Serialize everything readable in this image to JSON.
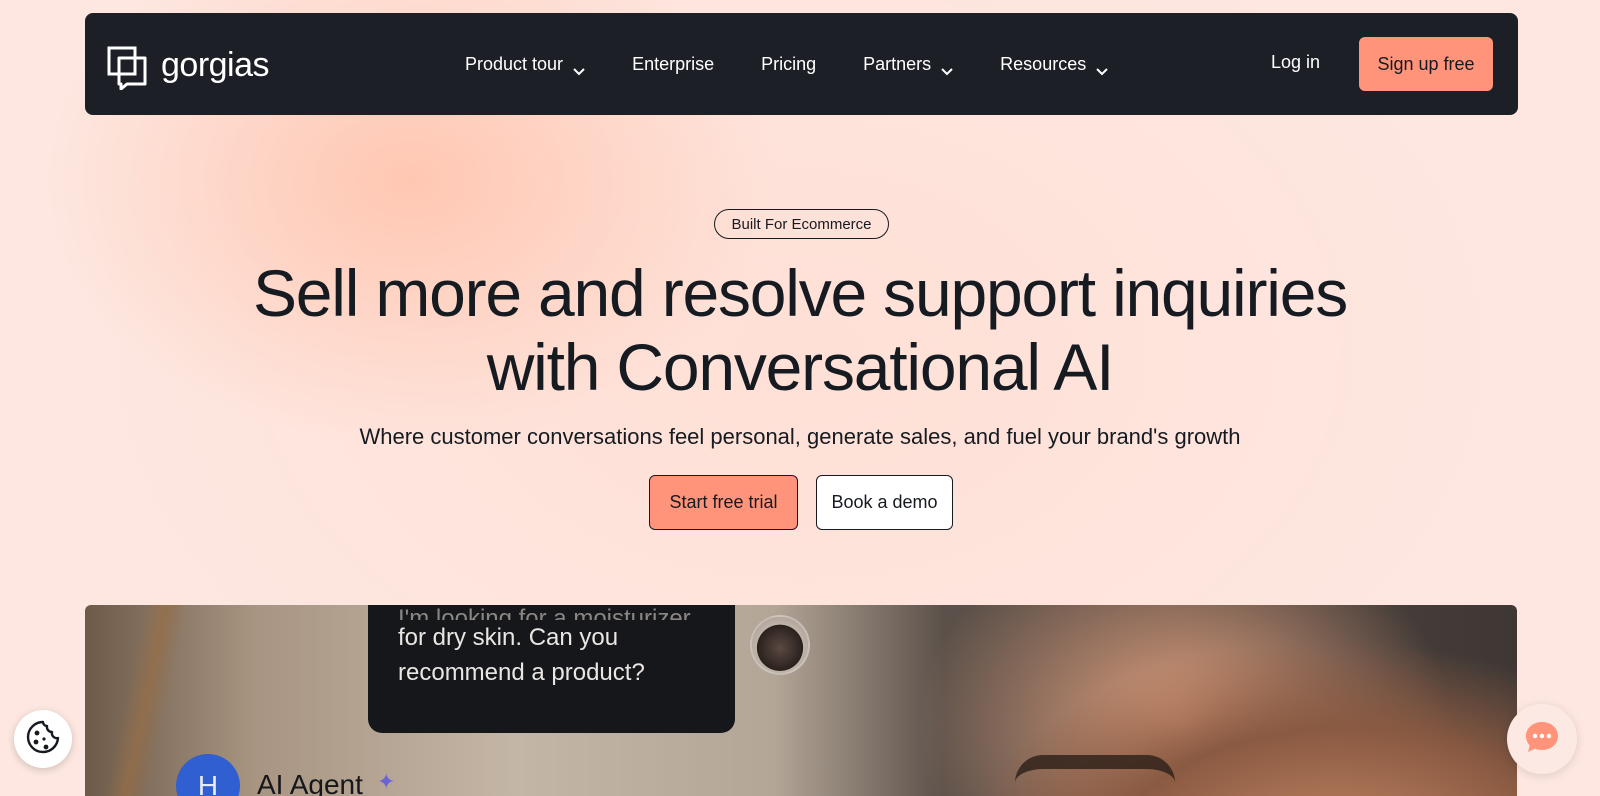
{
  "brand": {
    "name": "gorgias",
    "accent": "#ff947a",
    "nav_bg": "#1c1f26"
  },
  "nav": {
    "items": [
      {
        "label": "Product tour",
        "dropdown": true
      },
      {
        "label": "Enterprise",
        "dropdown": false
      },
      {
        "label": "Pricing",
        "dropdown": false
      },
      {
        "label": "Partners",
        "dropdown": true
      },
      {
        "label": "Resources",
        "dropdown": true
      }
    ],
    "login_label": "Log in",
    "signup_label": "Sign up free"
  },
  "hero": {
    "badge": "Built For Ecommerce",
    "headline_line1": "Sell more and resolve support inquiries",
    "headline_line2": "with Conversational AI",
    "subhead": "Where customer conversations feel personal, generate sales, and fuel your brand's growth",
    "primary_cta": "Start free trial",
    "secondary_cta": "Book a demo"
  },
  "media": {
    "chat_faded_line": "I'm looking for a moisturizer",
    "chat_line1": "for dry skin. Can you",
    "chat_line2": "recommend a product?",
    "agent_initial": "H",
    "agent_name": "AI Agent",
    "sparkle": "✦"
  },
  "icons": {
    "cookie": "cookie-icon",
    "chat": "chat-bubble-icon",
    "chevron": "chevron-down-icon"
  }
}
